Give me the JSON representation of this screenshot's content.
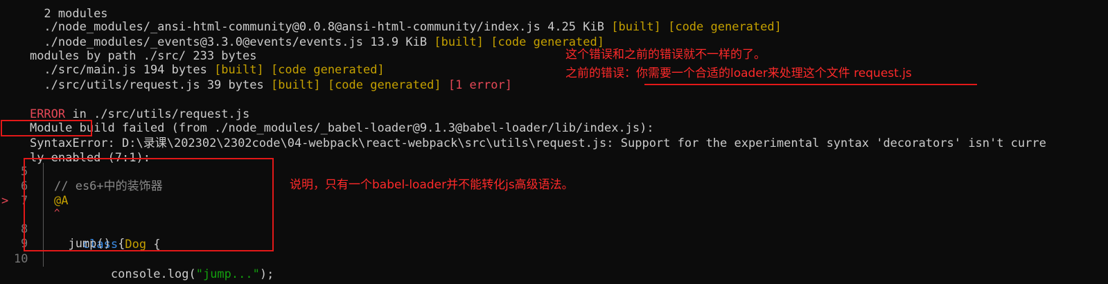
{
  "terminal": {
    "lines": {
      "l0": {
        "text": "  2 modules"
      },
      "l1": {
        "text": "  ./node_modules/_ansi-html-community@0.0.8@ansi-html-community/index.js 4.25 KiB ",
        "tags": "[built] [code generated]"
      },
      "l2": {
        "text": "  ./node_modules/_events@3.3.0@events/events.js 13.9 KiB ",
        "tags": "[built] [code generated]"
      },
      "l3": {
        "text": "modules by path ./src/ 233 bytes"
      },
      "l4": {
        "text": "  ./src/main.js 194 bytes ",
        "tags": "[built] [code generated]"
      },
      "l5": {
        "text": "  ./src/utils/request.js 39 bytes ",
        "tags": "[built] [code generated] ",
        "error": "[1 error]"
      },
      "l6": {
        "error_word": "ERROR",
        "text": " in ./src/utils/request.js"
      },
      "l7": {
        "text": "Module build failed (from ./node_modules/_babel-loader@9.1.3@babel-loader/lib/index.js):"
      },
      "l8": {
        "syntax": "SyntaxError:",
        "text": " D:\\录课\\202302\\2302code\\04-webpack\\react-webpack\\src\\utils\\request.js: Support for the experimental syntax 'decorators' isn't curre"
      },
      "l9": {
        "text": "ly enabled (7:1):"
      }
    },
    "code": {
      "ln5": "5",
      "ln6": "6",
      "ln7": "7",
      "ln8": "8",
      "ln9": "9",
      "ln10": "10",
      "marker": ">",
      "caret": "^",
      "comment": "// es6+中的装饰器",
      "decorator": "@A",
      "kw_class": "class",
      "class_name": "Dog",
      "brace_open": " {",
      "method": "  jump() {",
      "console": "    console.log(",
      "string": "\"jump...\"",
      "close": ");"
    }
  },
  "annotations": {
    "note1": "这个错误和之前的错误就不一样的了。",
    "note2": "之前的错误：你需要一个合适的loader来处理这个文件 request.js",
    "note3": "说明，只有一个babel-loader并不能转化js高级语法。"
  },
  "colors": {
    "annotation_red": "#ff2a2a",
    "terminal_bg": "#0c0c0c",
    "tag_yellow": "#c4a000",
    "error_red": "#e74856"
  }
}
